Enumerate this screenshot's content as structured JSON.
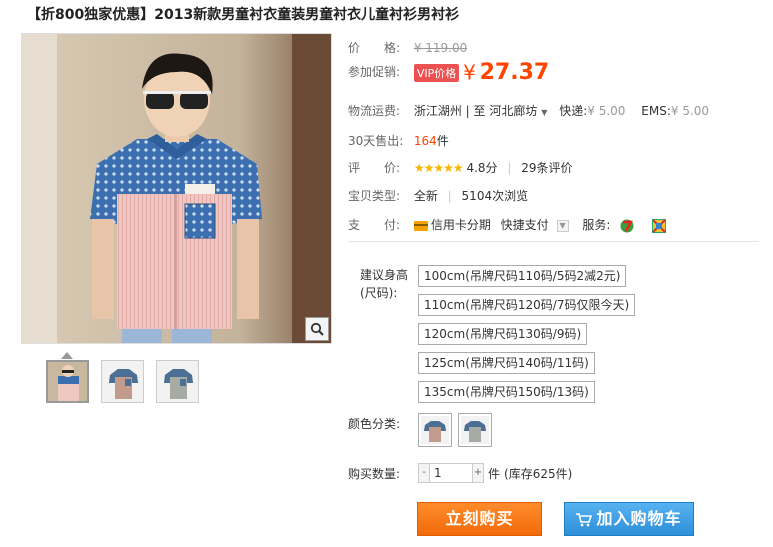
{
  "title": "【折800独家优惠】2013新款男童衬衣童装男童衬衣儿童衬衫男衬衫",
  "price": {
    "label": "价　　格:",
    "original": "¥ 119.00"
  },
  "promo": {
    "label": "参加促销:",
    "badge": "VIP价格",
    "yen": "¥",
    "price": "27.37"
  },
  "shipping": {
    "label": "物流运费:",
    "from": "浙江湖州",
    "sep": "|",
    "to_prefix": "至",
    "to": "河北廊坊",
    "express_label": "快递:",
    "express_price": "¥ 5.00",
    "ems_label": "EMS:",
    "ems_price": "¥ 5.00"
  },
  "sales": {
    "label": "30天售出:",
    "count": "164",
    "unit": "件"
  },
  "rating": {
    "label": "评　　价:",
    "stars": "★★★★★",
    "score": "4.8分",
    "reviews": "29条评价"
  },
  "type": {
    "label": "宝贝类型:",
    "value": "全新",
    "views": "5104次浏览"
  },
  "payment": {
    "label": "支　　付:",
    "card": "信用卡分期",
    "quick": "快捷支付",
    "service_label": "服务:"
  },
  "size": {
    "label": "建议身高(尺码):",
    "options": [
      "100cm(吊牌尺码110码/5码2减2元)",
      "110cm(吊牌尺码120码/7码仅限今天)",
      "120cm(吊牌尺码130码/9码)",
      "125cm(吊牌尺码140码/11码)",
      "135cm(吊牌尺码150码/13码)"
    ]
  },
  "color": {
    "label": "颜色分类:"
  },
  "quantity": {
    "label": "购买数量:",
    "minus": "-",
    "plus": "+",
    "value": "1",
    "unit": "件",
    "stock": "(库存625件)"
  },
  "buttons": {
    "buy": "立刻购买",
    "cart": "加入购物车"
  },
  "icons": {
    "zoom": "magnifier-icon",
    "cart": "cart-icon",
    "card": "credit-card-icon",
    "service7": "seven-day-return-icon",
    "service2": "quality-badge-icon"
  },
  "colors": {
    "accent": "#ff4400",
    "buy": "#f26a0a",
    "cart": "#2d8fd9",
    "star": "#f7b500"
  }
}
